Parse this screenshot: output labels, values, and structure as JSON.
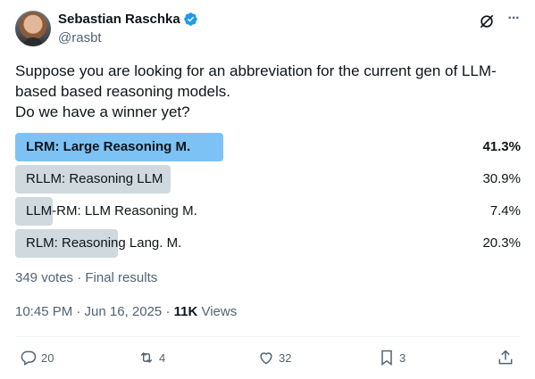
{
  "author": {
    "name": "Sebastian Raschka",
    "handle": "@rasbt"
  },
  "tweet": {
    "lines": [
      "Suppose you are looking for an abbreviation for the current gen of LLM-",
      "based based reasoning models.",
      "Do we have a winner yet?"
    ]
  },
  "poll": {
    "options": [
      {
        "label": "LRM: Large Reasoning M.",
        "percent": "41.3%",
        "fraction": 0.413,
        "winner": true
      },
      {
        "label": "RLLM: Reasoning LLM",
        "percent": "30.9%",
        "fraction": 0.309,
        "winner": false
      },
      {
        "label": "LLM-RM: LLM Reasoning M.",
        "percent": "7.4%",
        "fraction": 0.074,
        "winner": false
      },
      {
        "label": "RLM: Reasoning Lang. M.",
        "percent": "20.3%",
        "fraction": 0.203,
        "winner": false
      }
    ],
    "meta": "349 votes · Final results"
  },
  "timestamp": {
    "time_date": "10:45 PM · Jun 16, 2025 · ",
    "views_count": "11K",
    "views_label": " Views"
  },
  "actions": {
    "replies": "20",
    "reposts": "4",
    "likes": "32",
    "bookmarks": "3"
  },
  "colors": {
    "winner_bar": "#7dc2f5",
    "bar": "#cfd9de",
    "secondary_text": "#536471",
    "verified": "#1d9bf0"
  },
  "icons": [
    "verified-badge-icon",
    "grok-icon",
    "more-icon",
    "reply-icon",
    "repost-icon",
    "like-icon",
    "bookmark-icon",
    "share-icon"
  ]
}
